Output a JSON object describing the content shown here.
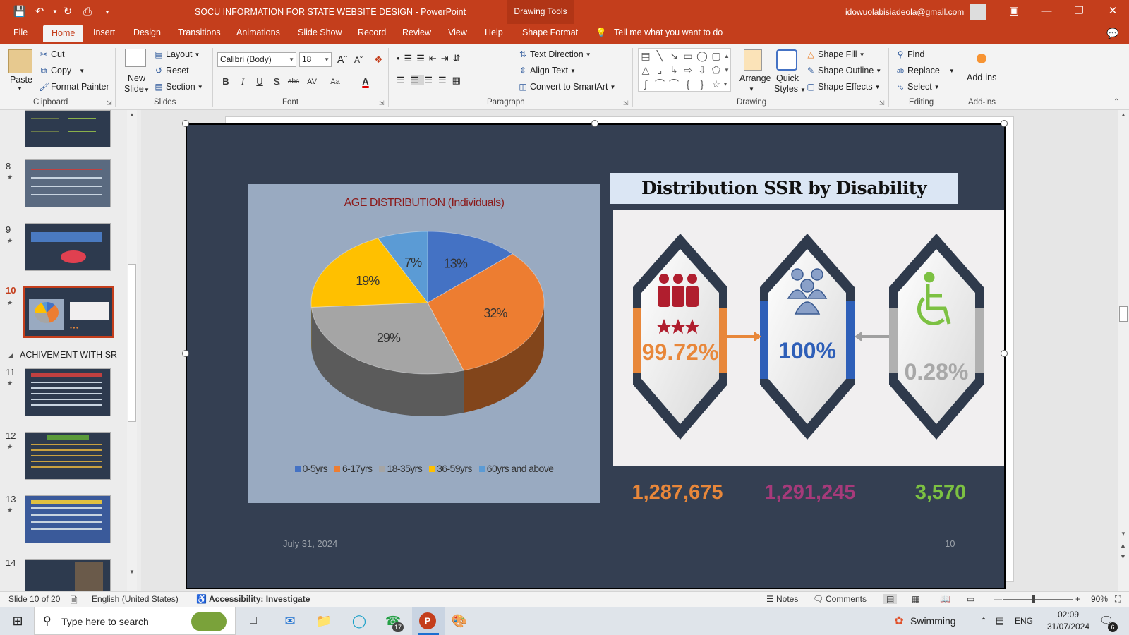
{
  "app": {
    "title": "SOCU INFORMATION FOR STATE WEBSITE DESIGN  -  PowerPoint",
    "context_label": "Drawing Tools",
    "account": "idowuolabisiadeola@gmail.com",
    "accent": "#c43e1c"
  },
  "tabs": [
    "File",
    "Home",
    "Insert",
    "Design",
    "Transitions",
    "Animations",
    "Slide Show",
    "Record",
    "Review",
    "View",
    "Help",
    "Shape Format"
  ],
  "tell_me": "Tell me what you want to do",
  "ribbon": {
    "clipboard": {
      "paste": "Paste",
      "cut": "Cut",
      "copy": "Copy",
      "format_painter": "Format Painter",
      "label": "Clipboard"
    },
    "slides": {
      "new_slide": "New",
      "new_slide2": "Slide",
      "layout": "Layout",
      "reset": "Reset",
      "section": "Section",
      "label": "Slides"
    },
    "font": {
      "family": "Calibri (Body)",
      "size": "18",
      "label": "Font",
      "bold": "B",
      "italic": "I",
      "underline": "U",
      "shadow": "S",
      "strike": "abc",
      "aa": "Aa"
    },
    "paragraph": {
      "text_direction": "Text Direction",
      "align_text": "Align Text",
      "smartart": "Convert to SmartArt",
      "label": "Paragraph"
    },
    "drawing": {
      "arrange": "Arrange",
      "quick_styles": "Quick",
      "quick_styles2": "Styles",
      "shape_fill": "Shape Fill",
      "shape_outline": "Shape Outline",
      "shape_effects": "Shape Effects",
      "label": "Drawing"
    },
    "editing": {
      "find": "Find",
      "replace": "Replace",
      "select": "Select",
      "label": "Editing"
    },
    "addins": {
      "addins": "Add-ins",
      "label": "Add-ins"
    }
  },
  "thumbnails": {
    "slides": [
      {
        "num": "8"
      },
      {
        "num": "9"
      },
      {
        "num": "10"
      },
      {
        "num": "11"
      },
      {
        "num": "12"
      },
      {
        "num": "13"
      },
      {
        "num": "14"
      }
    ],
    "section_title": "ACHIVEMENT WITH SR"
  },
  "slide": {
    "chart_title": "AGE DISTRIBUTION (Individuals)",
    "ssr_title": "Distribution SSR by Disability",
    "pct_1": "99.72%",
    "pct_2": "100%",
    "pct_3": "0.28%",
    "count_1": "1,287,675",
    "count_2": "1,291,245",
    "count_3": "3,570",
    "date": "July 31, 2024",
    "page": "10",
    "pct_colors": [
      "#e8873a",
      "#2e5fb8",
      "#a8a8a8"
    ],
    "count_colors": [
      "#e8873a",
      "#a63a7a",
      "#7cc142"
    ]
  },
  "chart_data": {
    "type": "pie",
    "title": "AGE DISTRIBUTION (Individuals)",
    "categories": [
      "0-5yrs",
      "6-17yrs",
      "18-35yrs",
      "36-59yrs",
      "60yrs and above"
    ],
    "values": [
      13,
      32,
      29,
      19,
      7
    ],
    "labels": [
      "13%",
      "32%",
      "29%",
      "19%",
      "7%"
    ],
    "colors": [
      "#4472c4",
      "#ed7d31",
      "#a5a5a5",
      "#ffc000",
      "#5b9bd5"
    ],
    "style": "3d",
    "legend": "bottom"
  },
  "status": {
    "slide_of": "Slide 10 of 20",
    "language": "English (United States)",
    "accessibility": "Accessibility: Investigate",
    "notes": "Notes",
    "comments": "Comments",
    "zoom": "90%"
  },
  "taskbar": {
    "search_placeholder": "Type here to search",
    "whatsapp_badge": "17",
    "weather": "Swimming",
    "lang": "ENG",
    "time": "02:09",
    "date": "31/07/2024",
    "notif": "6"
  }
}
